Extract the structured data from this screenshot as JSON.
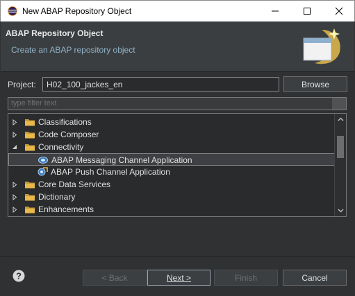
{
  "window": {
    "title": "New ABAP Repository Object",
    "icon": "eclipse-icon",
    "controls": [
      "minimize-icon",
      "maximize-icon",
      "close-icon"
    ]
  },
  "banner": {
    "title": "ABAP Repository Object",
    "subtitle": "Create an ABAP repository object",
    "image": "wizard-banner-icon"
  },
  "project": {
    "label": "Project:",
    "value": "H02_100_jackes_en",
    "browse_label": "Browse"
  },
  "filter": {
    "placeholder": "type filter text"
  },
  "tree": {
    "items": [
      {
        "label": "Classifications",
        "level": 0,
        "expanded": false,
        "icon": "folder-icon"
      },
      {
        "label": "Code Composer",
        "level": 0,
        "expanded": false,
        "icon": "folder-icon"
      },
      {
        "label": "Connectivity",
        "level": 0,
        "expanded": true,
        "icon": "folder-icon"
      },
      {
        "label": "ABAP Messaging Channel Application",
        "level": 1,
        "selected": true,
        "icon": "amc-icon"
      },
      {
        "label": "ABAP Push Channel Application",
        "level": 1,
        "icon": "apc-icon"
      },
      {
        "label": "Core Data Services",
        "level": 0,
        "expanded": false,
        "icon": "folder-icon"
      },
      {
        "label": "Dictionary",
        "level": 0,
        "expanded": false,
        "icon": "folder-icon"
      },
      {
        "label": "Enhancements",
        "level": 0,
        "expanded": false,
        "icon": "folder-icon"
      }
    ]
  },
  "footer": {
    "help_icon": "help-icon",
    "back_label": "< Back",
    "next_label": "Next >",
    "finish_label": "Finish",
    "cancel_label": "Cancel"
  },
  "colors": {
    "background": "#2f3133",
    "banner": "#3b3e41",
    "subtitle": "#8fb3c8",
    "folder": "#e8b84a"
  }
}
